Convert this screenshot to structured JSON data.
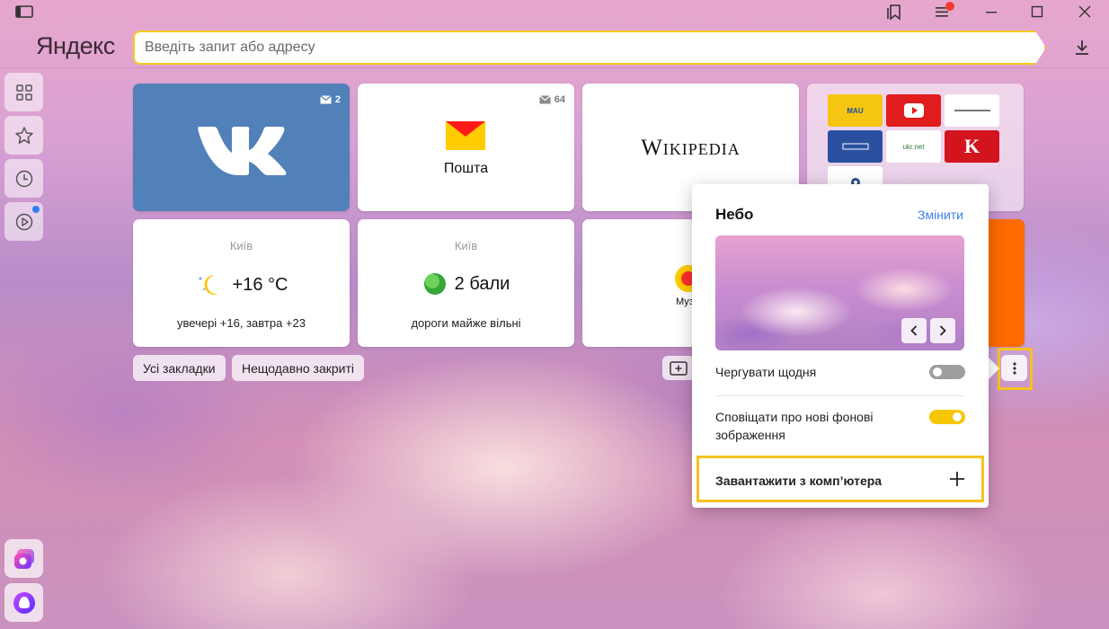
{
  "browser": {
    "logo": "Яндекс",
    "address_placeholder": "Введіть запит або адресу"
  },
  "tiles": {
    "vk": {
      "mail_count": "2"
    },
    "mail": {
      "name": "Пошта",
      "mail_count": "64"
    },
    "wiki": {
      "name": "Wikipedia"
    },
    "group": {
      "mau": "MAU",
      "ukrnet": "ukr.net",
      "k": "K"
    },
    "weather": {
      "city": "Київ",
      "temp": "+16 °C",
      "forecast": "увечері +16, завтра +23"
    },
    "traffic": {
      "city": "Київ",
      "score": "2 бали",
      "status": "дороги майже вільні"
    },
    "music": {
      "label": "Муз"
    }
  },
  "buttons": {
    "all_bookmarks": "Усі закладки",
    "recently_closed": "Нещодавно закриті"
  },
  "background_popup": {
    "title": "Небо",
    "change": "Змінити",
    "alternate_daily": "Чергувати щодня",
    "alternate_daily_on": false,
    "notify_new": "Сповіщати про нові фонові зображення",
    "notify_new_on": true,
    "upload": "Завантажити з комп’ютера"
  },
  "colors": {
    "accent_yellow": "#f7cb1f",
    "vk_blue": "#5181b8",
    "link_blue": "#3f7ee8"
  }
}
